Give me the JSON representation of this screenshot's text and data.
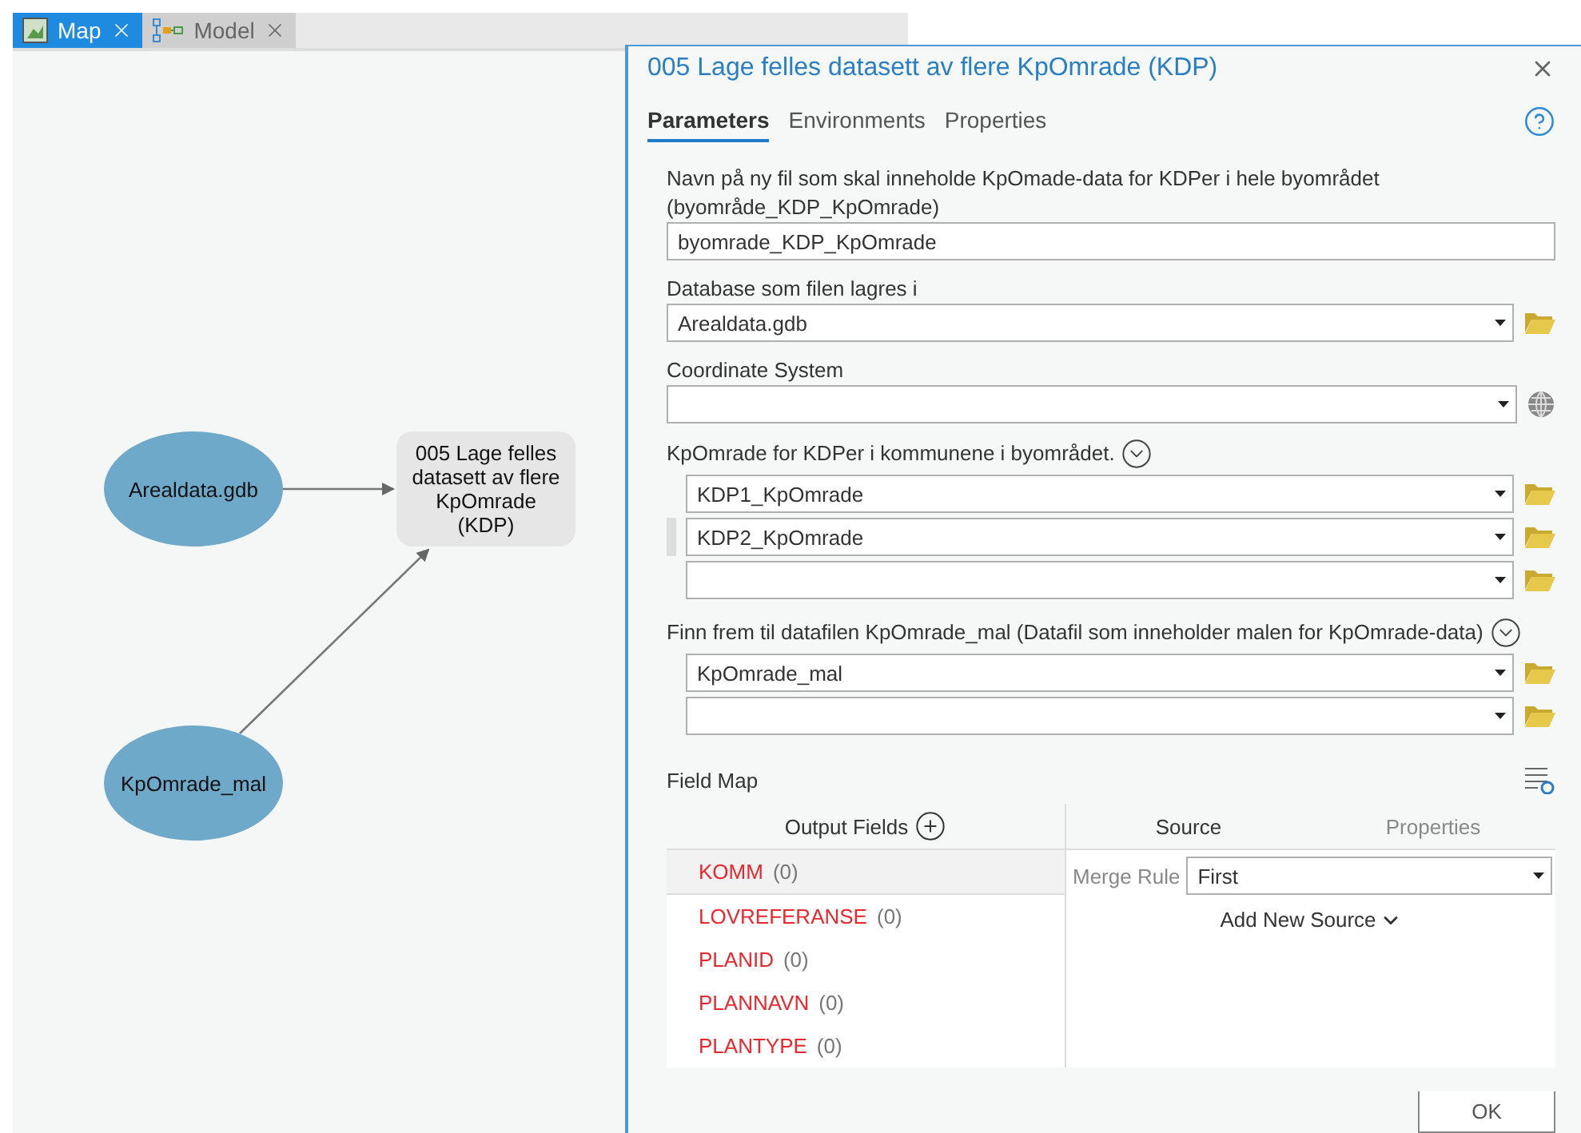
{
  "view_tabs": [
    {
      "label": "Map",
      "selected": true,
      "kind": "map"
    },
    {
      "label": "Model",
      "selected": false,
      "kind": "model"
    }
  ],
  "canvas": {
    "nodes": [
      {
        "label": "Arealdata.gdb",
        "kind": "data"
      },
      {
        "label": "005 Lage felles datasett av flere KpOmrade (KDP)",
        "kind": "tool"
      },
      {
        "label": "KpOmrade_mal",
        "kind": "data"
      }
    ]
  },
  "dialog": {
    "title": "005 Lage felles datasett av flere KpOmrade (KDP)",
    "tabs": [
      {
        "label": "Parameters",
        "selected": true
      },
      {
        "label": "Environments",
        "selected": false
      },
      {
        "label": "Properties",
        "selected": false
      }
    ],
    "parameters": [
      {
        "kind": "text",
        "label": "Navn på ny fil som skal inneholde KpOmade-data for KDPer i hele byområdet (byområde_KDP_KpOmrade)",
        "value": "byomrade_KDP_KpOmrade"
      },
      {
        "kind": "dataset",
        "label": "Database som filen lagres i",
        "value": "Arealdata.gdb"
      },
      {
        "kind": "coordinate",
        "label": "Coordinate System"
      },
      {
        "kind": "multi",
        "label": "KpOmrade for KDPer i  kommunene i byområdet.",
        "rows": [
          {
            "value": "KDP1_KpOmrade",
            "selected": false
          },
          {
            "value": "KDP2_KpOmrade",
            "selected": true
          },
          {
            "selected": false
          }
        ]
      },
      {
        "kind": "multi",
        "label": "Finn frem til datafilen KpOmrade_mal (Datafil som inneholder malen for KpOmrade-data)",
        "rows": [
          {
            "value": "KpOmrade_mal",
            "selected": false
          },
          {
            "selected": false
          }
        ]
      }
    ],
    "field_map": {
      "title": "Field Map",
      "output_header": "Output Fields",
      "fields": [
        {
          "name": "KOMM",
          "count": "(0)",
          "selected": true
        },
        {
          "name": "LOVREFERANSE",
          "count": "(0)",
          "selected": false
        },
        {
          "name": "PLANID",
          "count": "(0)",
          "selected": false
        },
        {
          "name": "PLANNAVN",
          "count": "(0)",
          "selected": false
        },
        {
          "name": "PLANTYPE",
          "count": "(0)",
          "selected": false
        }
      ],
      "source_tabs": [
        {
          "label": "Source",
          "selected": true
        },
        {
          "label": "Properties",
          "selected": false
        }
      ],
      "merge_rule_label": "Merge Rule",
      "merge_rule": "First",
      "add_source": "Add New Source"
    },
    "ok_button": "OK"
  }
}
